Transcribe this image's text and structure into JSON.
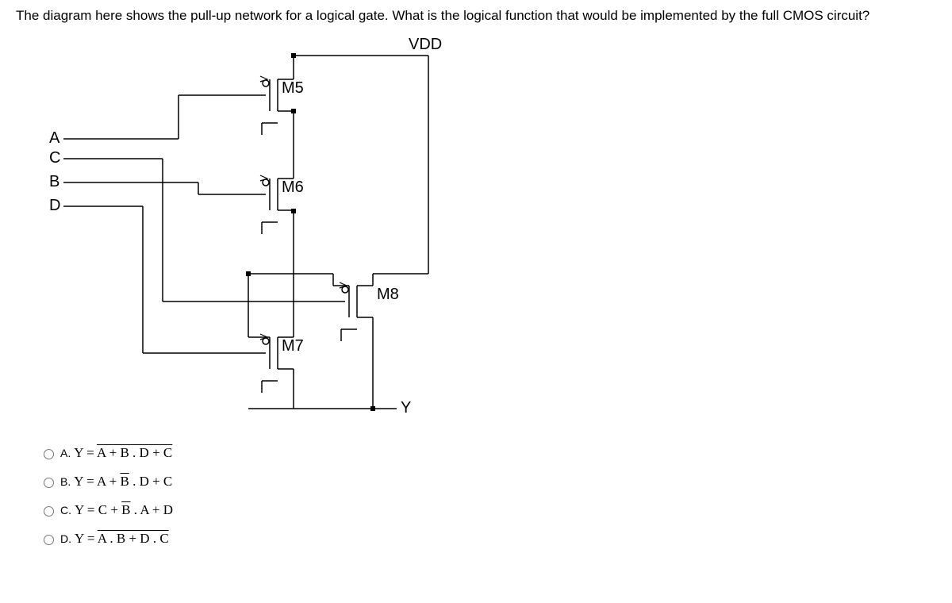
{
  "question": "The diagram here shows the pull-up network for a logical gate. What is the logical function that would be implemented by the full CMOS circuit?",
  "labels": {
    "vdd": "VDD",
    "A": "A",
    "B": "B",
    "C": "C",
    "D": "D",
    "M5": "M5",
    "M6": "M6",
    "M7": "M7",
    "M8": "M8",
    "Y": "Y"
  },
  "options": {
    "A": {
      "letter": "A.",
      "pre": "Y = ",
      "ovl": "A + B . D + C"
    },
    "B": {
      "letter": "B.",
      "pre": "Y = A + ",
      "mid1": "B",
      "mid2": " . D + C"
    },
    "C": {
      "letter": "C.",
      "pre": "Y = C + ",
      "mid1": "B",
      "mid2": " . A + D"
    },
    "D": {
      "letter": "D.",
      "pre": "Y = ",
      "ovl": "A . B + D . C"
    }
  }
}
